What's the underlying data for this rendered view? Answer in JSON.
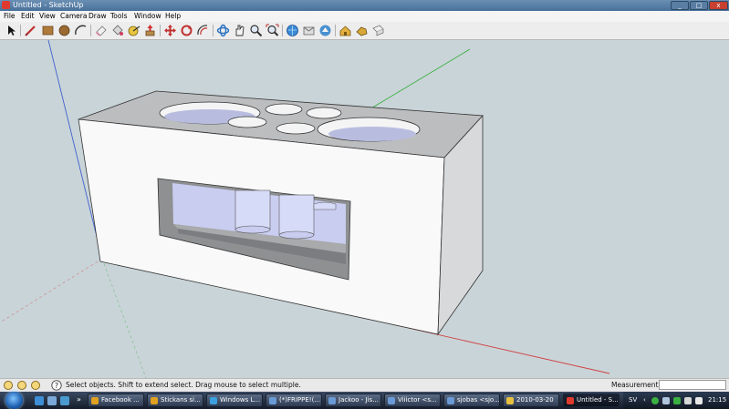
{
  "window": {
    "title": "Untitled - SketchUp",
    "min_glyph": "_",
    "max_glyph": "□",
    "close_glyph": "x"
  },
  "menu": {
    "items": [
      "File",
      "Edit",
      "View",
      "Camera",
      "Draw",
      "Tools",
      "Window",
      "Help"
    ]
  },
  "toolbar": {
    "tools": [
      "select-icon",
      "pencil-line-icon",
      "rectangle-icon",
      "circle-icon",
      "arc-icon",
      "eraser-icon",
      "paint-bucket-icon",
      "tape-measure-icon",
      "push-pull-icon",
      "move-icon",
      "rotate-icon",
      "offset-icon",
      "orbit-icon",
      "pan-icon",
      "zoom-icon",
      "zoom-extents-icon",
      "get-models-icon",
      "share-model-icon",
      "components-icon",
      "warehouse-icon",
      "camera-icon",
      "section-icon"
    ]
  },
  "status": {
    "message": "Select objects. Shift to extend select. Drag mouse to select multiple.",
    "measurements_label": "Measurements",
    "measurements_value": ""
  },
  "taskbar": {
    "tasks": [
      {
        "label": "Facebook ...",
        "icon_color": "#e0a020"
      },
      {
        "label": "Stickans si...",
        "icon_color": "#e0a020"
      },
      {
        "label": "Windows L...",
        "icon_color": "#3aa0e0"
      },
      {
        "label": "(*)FRIPPE!(...",
        "icon_color": "#6a9ad6"
      },
      {
        "label": "Jackoo - Jis...",
        "icon_color": "#6a9ad6"
      },
      {
        "label": "Viiictor <s...",
        "icon_color": "#6a9ad6"
      },
      {
        "label": "sjobas <sjo...",
        "icon_color": "#6a9ad6"
      },
      {
        "label": "2010-03-20",
        "icon_color": "#e8c040"
      },
      {
        "label": "Untitled - S...",
        "icon_color": "#e03a2f"
      }
    ],
    "language": "SV",
    "clock": "21:15"
  },
  "colors": {
    "accent": "#48709a",
    "viewport": "#c9d4d8",
    "red_axis": "#d04040",
    "green_axis": "#3ab040",
    "blue_axis": "#4060d0"
  }
}
